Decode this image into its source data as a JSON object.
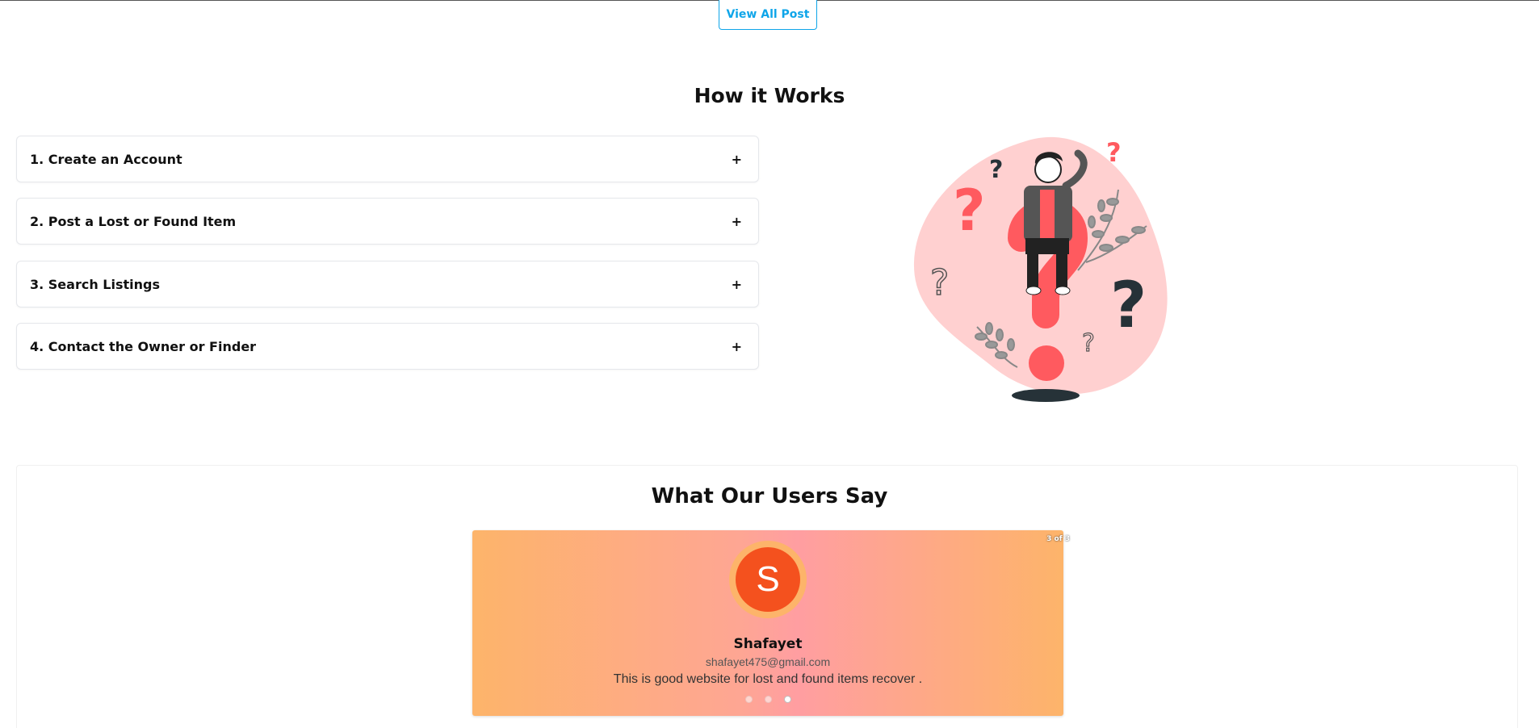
{
  "top": {
    "view_all_label": "View All Post"
  },
  "how_it_works": {
    "title": "How it Works",
    "steps": [
      {
        "label": "1. Create an Account",
        "toggle": "+"
      },
      {
        "label": "2. Post a Lost or Found Item",
        "toggle": "+"
      },
      {
        "label": "3. Search Listings",
        "toggle": "+"
      },
      {
        "label": "4. Contact the Owner or Finder",
        "toggle": "+"
      }
    ],
    "illustration_icon": "confused-person-question-marks-illustration"
  },
  "testimonials": {
    "title": "What Our Users Say",
    "counter": "3 of 3",
    "current": {
      "initial": "S",
      "name": "Shafayet",
      "email": "shafayet475@gmail.com",
      "quote": "This is good website for lost and found items recover ."
    },
    "dots": 3,
    "active_dot": 3
  },
  "colors": {
    "accent": "#0ea5e9",
    "avatar": "#f4511e",
    "coral": "#ff5a5f",
    "blob": "#ffd0d0",
    "slide_gradient_edge": "#fdb46a",
    "slide_gradient_mid": "#ff9ea1"
  }
}
